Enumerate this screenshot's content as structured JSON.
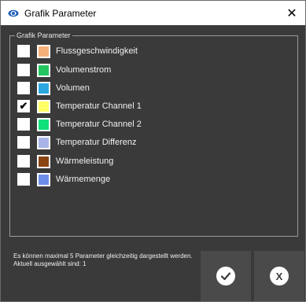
{
  "window": {
    "title": "Grafik Parameter",
    "close_label": "✕"
  },
  "group": {
    "legend": "Grafik Parameter"
  },
  "params": [
    {
      "label": "Flussgeschwindigkeit",
      "color": "#f5b07a",
      "checked": false
    },
    {
      "label": "Volumenstrom",
      "color": "#22c55e",
      "checked": false
    },
    {
      "label": "Volumen",
      "color": "#2ba7e0",
      "checked": false
    },
    {
      "label": "Temperatur Channel 1",
      "color": "#ffff66",
      "checked": true
    },
    {
      "label": "Temperatur Channel 2",
      "color": "#10e07a",
      "checked": false
    },
    {
      "label": "Temperatur Differenz",
      "color": "#a8b4e8",
      "checked": false
    },
    {
      "label": "Wärmeleistung",
      "color": "#8b4513",
      "checked": false
    },
    {
      "label": "Wärmemenge",
      "color": "#6d8de8",
      "checked": false
    }
  ],
  "info": {
    "text": "Es können maximal 5 Parameter gleichzeitig dargestellt werden. Aktuell ausgewählt sind: 1"
  },
  "buttons": {
    "ok_icon": "check-icon",
    "cancel_label": "X"
  }
}
